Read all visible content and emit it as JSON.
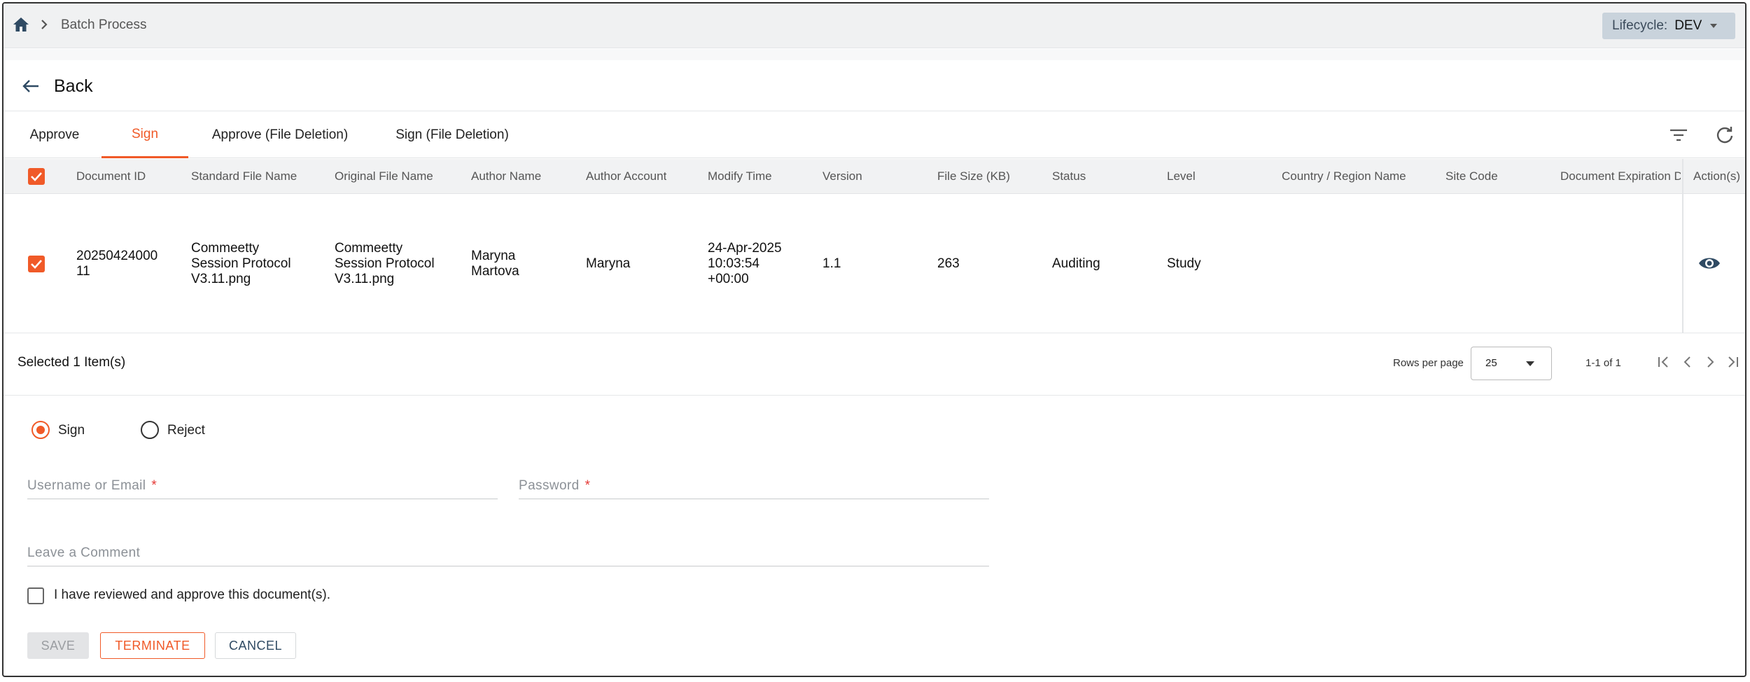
{
  "breadcrumb": {
    "current": "Batch Process"
  },
  "lifecycle": {
    "label": "Lifecycle:",
    "value": "DEV"
  },
  "back": {
    "label": "Back"
  },
  "tabs": [
    {
      "label": "Approve",
      "active": false
    },
    {
      "label": "Sign",
      "active": true
    },
    {
      "label": "Approve (File Deletion)",
      "active": false
    },
    {
      "label": "Sign (File Deletion)",
      "active": false
    }
  ],
  "table": {
    "columns": [
      "Document ID",
      "Standard File Name",
      "Original File Name",
      "Author Name",
      "Author Account",
      "Modify Time",
      "Version",
      "File Size (KB)",
      "Status",
      "Level",
      "Country / Region Name",
      "Site Code",
      "Document Expiration D",
      "Action(s)"
    ],
    "rows": [
      {
        "checked": true,
        "document_id": [
          "20250424000",
          "11"
        ],
        "standard_file_name": [
          "Commeetty",
          "Session Protocol",
          "V3.11.png"
        ],
        "original_file_name": [
          "Commeetty",
          "Session Protocol",
          "V3.11.png"
        ],
        "author_name": [
          "Maryna",
          "Martova"
        ],
        "author_account": "Maryna",
        "modify_time": [
          "24-Apr-2025",
          "10:03:54",
          "+00:00"
        ],
        "version": "1.1",
        "file_size": "263",
        "status": "Auditing",
        "level": "Study",
        "country": "",
        "site_code": "",
        "expiration": ""
      }
    ]
  },
  "footer": {
    "selected_text": "Selected 1 Item(s)",
    "rows_per_page_label": "Rows per page",
    "rows_per_page_value": "25",
    "page_info": "1-1 of 1"
  },
  "form": {
    "options": [
      {
        "label": "Sign",
        "selected": true
      },
      {
        "label": "Reject",
        "selected": false
      }
    ],
    "username_placeholder": "Username or Email",
    "password_placeholder": "Password",
    "required_mark": "*",
    "comment_placeholder": "Leave a Comment",
    "agree_label": "I have reviewed and approve this document(s).",
    "agree_checked": false
  },
  "buttons": {
    "save": "SAVE",
    "terminate": "TERMINATE",
    "cancel": "CANCEL"
  },
  "colors": {
    "accent": "#f05a28",
    "topbar": "#f0f1f2",
    "lifecycle_bg": "#c9d3dc"
  },
  "icons": [
    "home-icon",
    "chevron-right-icon",
    "arrow-left-icon",
    "filter-icon",
    "refresh-icon",
    "eye-icon",
    "first-page-icon",
    "prev-page-icon",
    "next-page-icon",
    "last-page-icon"
  ]
}
